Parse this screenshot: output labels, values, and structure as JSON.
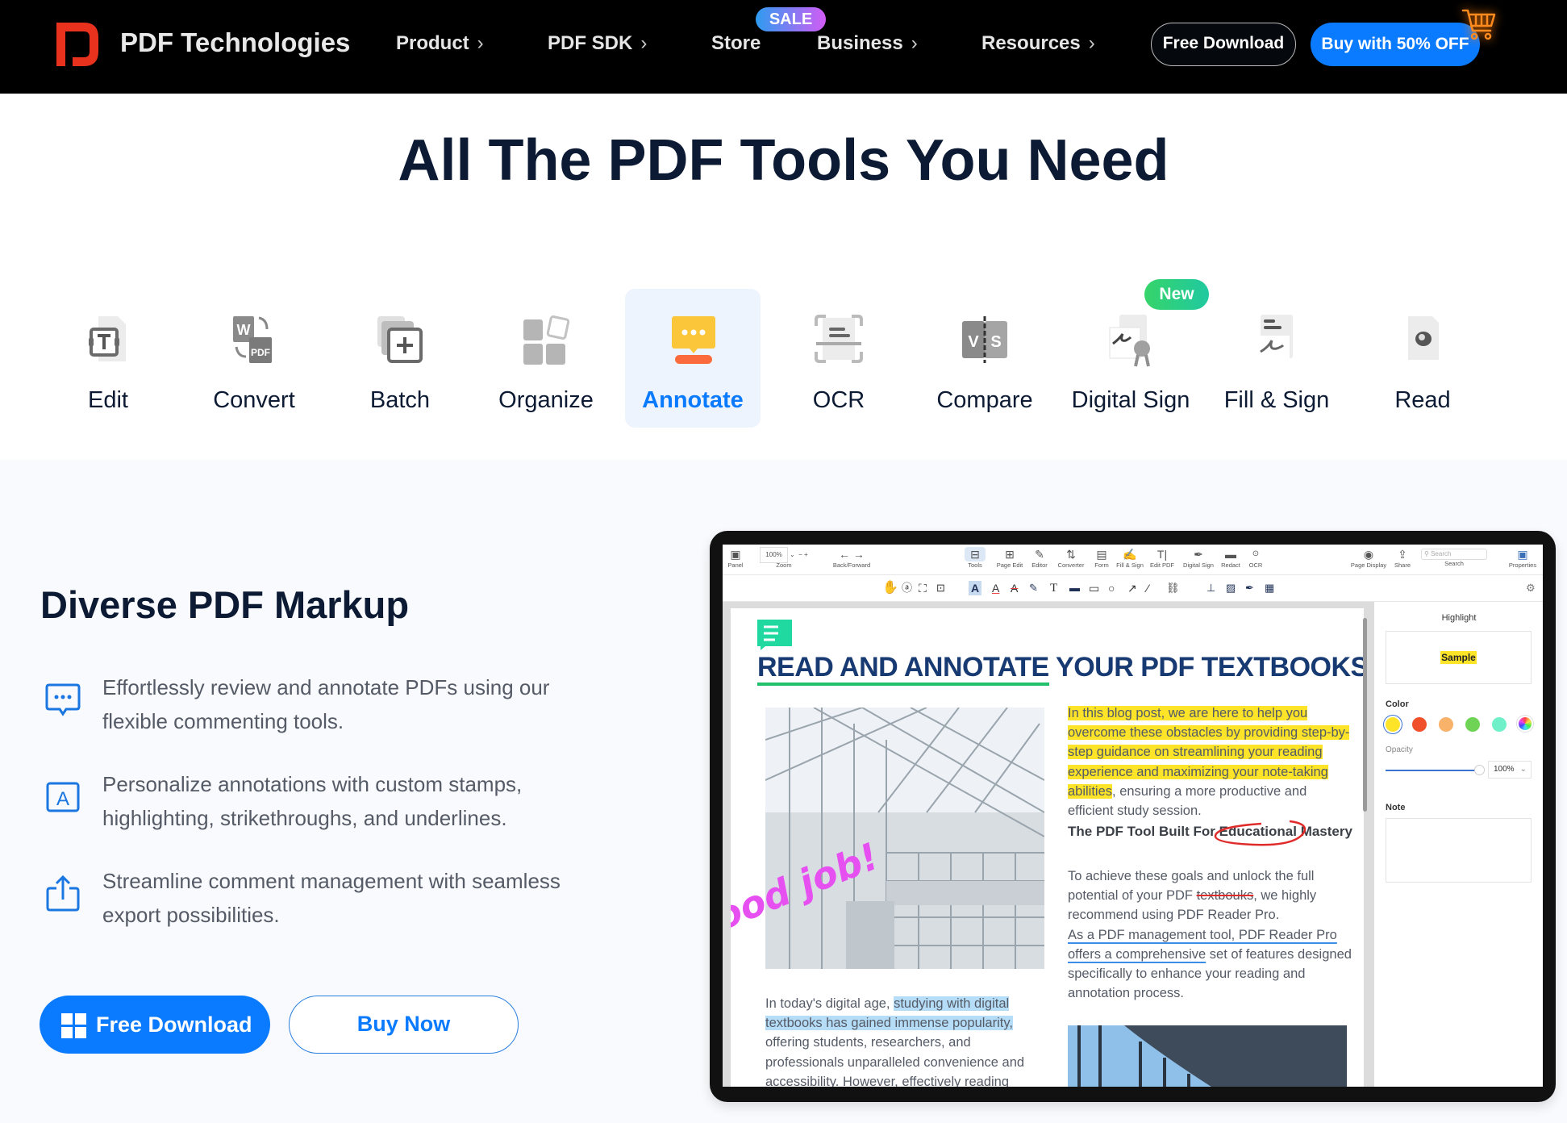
{
  "header": {
    "brand": "PDF Technologies",
    "nav": [
      {
        "label": "Product",
        "chevron": "›"
      },
      {
        "label": "PDF SDK",
        "chevron": "›"
      },
      {
        "label": "Store",
        "chevron": ""
      },
      {
        "label": "Business",
        "chevron": "›"
      },
      {
        "label": "Resources",
        "chevron": "›"
      }
    ],
    "sale_badge": "SALE",
    "free_download": "Free Download",
    "buy_offer": "Buy with 50% OFF",
    "cart_icon": "shopping-cart-icon"
  },
  "hero": {
    "title": "All The PDF Tools You Need"
  },
  "tools": {
    "active": "Annotate",
    "new_badge": "New",
    "items": [
      {
        "label": "Edit",
        "icon": "edit-text-icon"
      },
      {
        "label": "Convert",
        "icon": "word-to-pdf-icon"
      },
      {
        "label": "Batch",
        "icon": "batch-add-icon"
      },
      {
        "label": "Organize",
        "icon": "organize-pages-icon"
      },
      {
        "label": "Annotate",
        "icon": "annotate-comment-icon"
      },
      {
        "label": "OCR",
        "icon": "ocr-scan-icon"
      },
      {
        "label": "Compare",
        "icon": "compare-vs-icon"
      },
      {
        "label": "Digital Sign",
        "icon": "digital-sign-icon"
      },
      {
        "label": "Fill & Sign",
        "icon": "fill-sign-icon"
      },
      {
        "label": "Read",
        "icon": "read-eye-icon"
      }
    ]
  },
  "section": {
    "title": "Diverse PDF Markup",
    "features": [
      {
        "icon": "comment-dots-icon",
        "text": "Effortlessly review and annotate PDFs using our flexible commenting tools."
      },
      {
        "icon": "text-box-icon",
        "text": "Personalize annotations with custom stamps, highlighting, strikethroughs, and underlines."
      },
      {
        "icon": "share-export-icon",
        "text": "Streamline comment management with seamless export possibilities."
      }
    ],
    "free_download": "Free Download",
    "buy_now": "Buy Now"
  },
  "app": {
    "toolbar1": {
      "panel": "Panel",
      "zoom_value": "100%",
      "zoom": "Zoom",
      "back_forward": "Back/Forward",
      "tools": [
        "Tools",
        "Page Edit",
        "Editor",
        "Converter",
        "Form",
        "Fill & Sign",
        "Edit PDF",
        "Digital Sign",
        "Redact",
        "OCR"
      ],
      "page_display": "Page Display",
      "share": "Share",
      "search_placeholder": "Search",
      "search": "Search",
      "properties": "Properties"
    },
    "document": {
      "title_underlined": "READ AND ANNOTATE",
      "title_rest": " YOUR PDF TEXTBOOKS",
      "stamp": "Good job!",
      "left_pre": "In today's digital age, ",
      "left_hl": "studying with digital textbooks has gained immense popularity,",
      "left_post": " offering students, researchers, and professionals unparalleled convenience and accessibility. However, effectively reading",
      "right_hl": "In this blog post, we are here to help you overcome these obstacles by providing step-by-step guidance on streamlining your reading experience and maximizing your note-taking abilities",
      "right_post": ", ensuring a more productive and efficient study session.",
      "heading_pre": "The PDF Tool Built For ",
      "heading_circled": "Educational",
      "heading_post": " Mastery",
      "p2_pre": "To achieve these goals and unlock the full potential of your PDF ",
      "p2_strike": "textbouks",
      "p2_post": ", we highly recommend using PDF Reader Pro.",
      "p3_underline": "As a PDF management tool, PDF Reader Pro offers a comprehensive",
      "p3_post": " set of features designed specifically to enhance your reading and annotation process."
    },
    "panel": {
      "title": "Highlight",
      "sample": "Sample",
      "color_label": "Color",
      "colors": [
        "#fde428",
        "#f0502a",
        "#f8b26a",
        "#6fd455",
        "#6ff0c8"
      ],
      "selected_color": "#fde428",
      "opacity_label": "Opacity",
      "opacity_value": "100%",
      "opacity_fraction": 1.0,
      "note_label": "Note"
    }
  },
  "colors": {
    "accent": "#0a7aff",
    "navy": "#0c1b33",
    "highlight": "#fde428",
    "stamp": "#e64ff0"
  }
}
